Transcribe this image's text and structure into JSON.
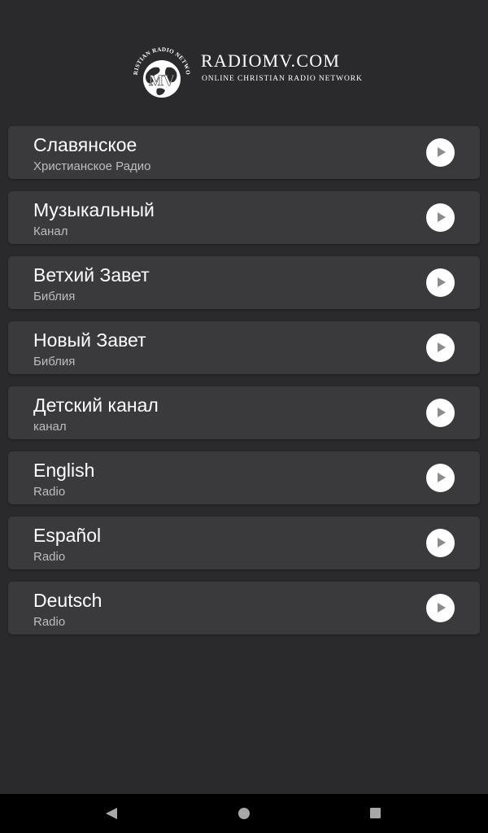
{
  "header": {
    "logo_title": "RADIOMV.COM",
    "logo_subtitle": "ONLINE CHRISTIAN RADIO NETWORK",
    "emblem_ring_text": "CHRISTIAN RADIO NETWORK",
    "emblem_letters": "MV"
  },
  "channels": [
    {
      "title": "Славянское",
      "subtitle": "Христианское Радио",
      "icon": "play-icon"
    },
    {
      "title": "Музыкальный",
      "subtitle": "Канал",
      "icon": "play-icon"
    },
    {
      "title": "Ветхий Завет",
      "subtitle": "Библия",
      "icon": "play-icon"
    },
    {
      "title": "Новый Завет",
      "subtitle": "Библия",
      "icon": "play-icon"
    },
    {
      "title": "Детский канал",
      "subtitle": "канал",
      "icon": "play-icon"
    },
    {
      "title": "English",
      "subtitle": "Radio",
      "icon": "play-icon"
    },
    {
      "title": "Español",
      "subtitle": "Radio",
      "icon": "play-icon"
    },
    {
      "title": "Deutsch",
      "subtitle": "Radio",
      "icon": "play-icon"
    }
  ],
  "nav_bar": {
    "back_icon": "back-triangle-icon",
    "home_icon": "home-circle-icon",
    "recents_icon": "recents-square-icon"
  },
  "colors": {
    "background": "#2a292b",
    "card": "#3a393b",
    "title_text": "#ffffff",
    "subtitle_text": "#bdbcbe",
    "play_button": "#ffffff",
    "play_glyph": "#8c8b8d",
    "nav_bar": "#000000"
  }
}
